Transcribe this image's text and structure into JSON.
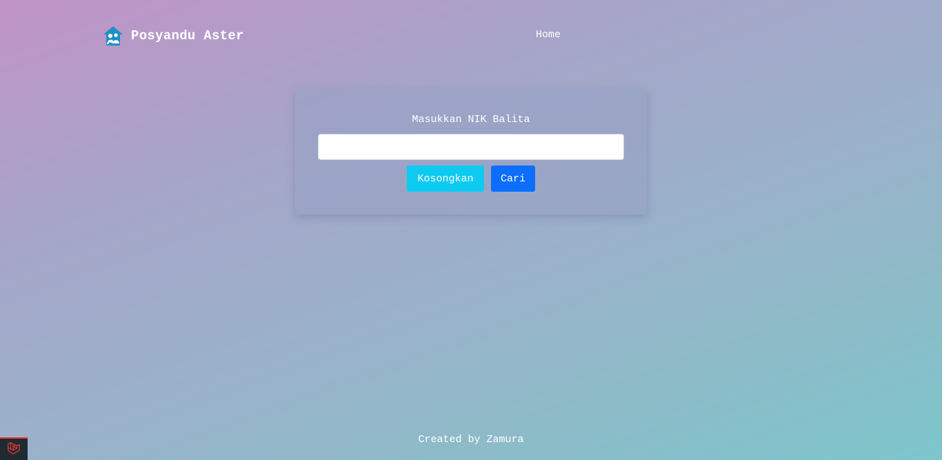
{
  "header": {
    "brand_name": "Posyandu Aster",
    "logo_icon": "family-home-icon",
    "nav": [
      {
        "label": "Home"
      }
    ]
  },
  "search_card": {
    "label": "Masukkan NIK Balita",
    "input_value": "",
    "clear_button_label": "Kosongkan",
    "search_button_label": "Cari"
  },
  "footer": {
    "text": "Created by Zamura"
  },
  "debug_badge": {
    "icon": "laravel-icon"
  },
  "colors": {
    "clear_button": "#0dcaf0",
    "search_button": "#0d6efd",
    "logo": "#1f8fc4",
    "badge_accent": "#ef3b2d"
  }
}
